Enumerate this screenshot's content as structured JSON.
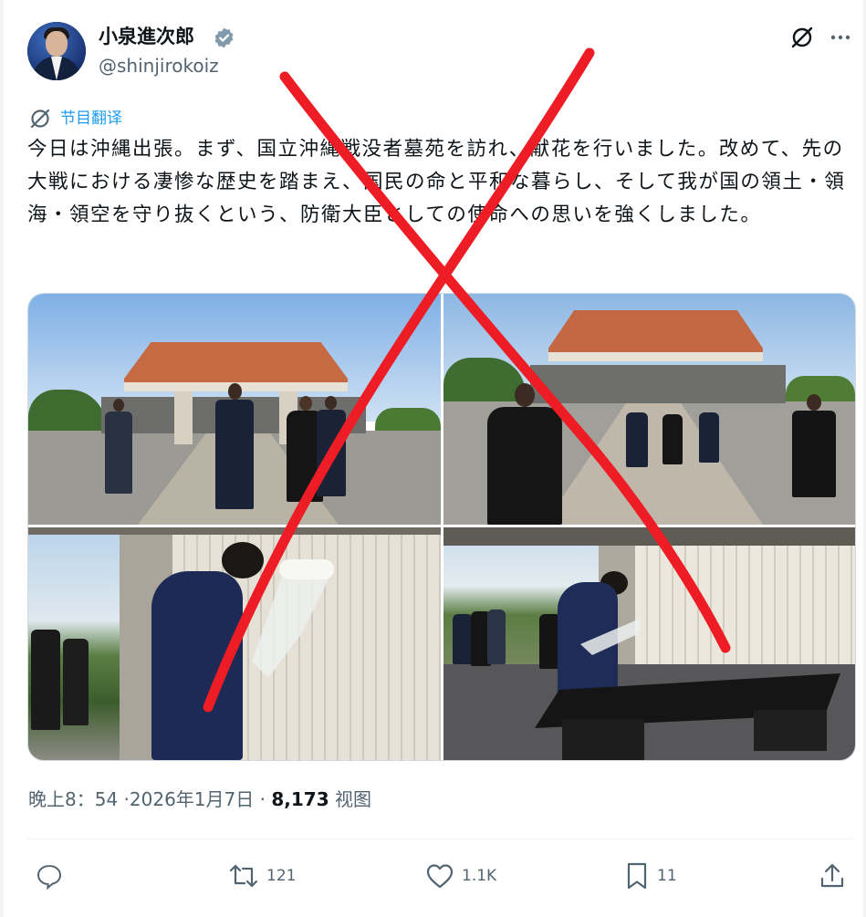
{
  "author": {
    "display_name": "小泉進次郎",
    "handle": "@shinjirokoiz"
  },
  "translate_label": "节目翻译",
  "tweet_text": "今日は沖縄出張。まず、国立沖縄戦没者墓苑を訪れ、献花を行いました。改めて、先の大戦における凄惨な歴史を踏まえ、国民の命と平和な暮らし、そして我が国の領土・領海・領空を守り抜くという、防衛大臣としての使命への思いを強くしました。",
  "meta": {
    "time": "晚上8：54",
    "date": "2026年1月7日",
    "views_count": "8,173",
    "views_label": "视图"
  },
  "actions": {
    "retweets": "121",
    "likes": "1.1K",
    "bookmarks": "11"
  },
  "icons": [
    "grok-icon",
    "more-icon",
    "verified-badge-icon",
    "translate-icon",
    "reply-icon",
    "retweet-icon",
    "like-icon",
    "bookmark-icon",
    "share-icon"
  ],
  "colors": {
    "accent": "#1d9bf0",
    "secondary_text": "#536471",
    "cross_mark": "#ee1c24"
  }
}
